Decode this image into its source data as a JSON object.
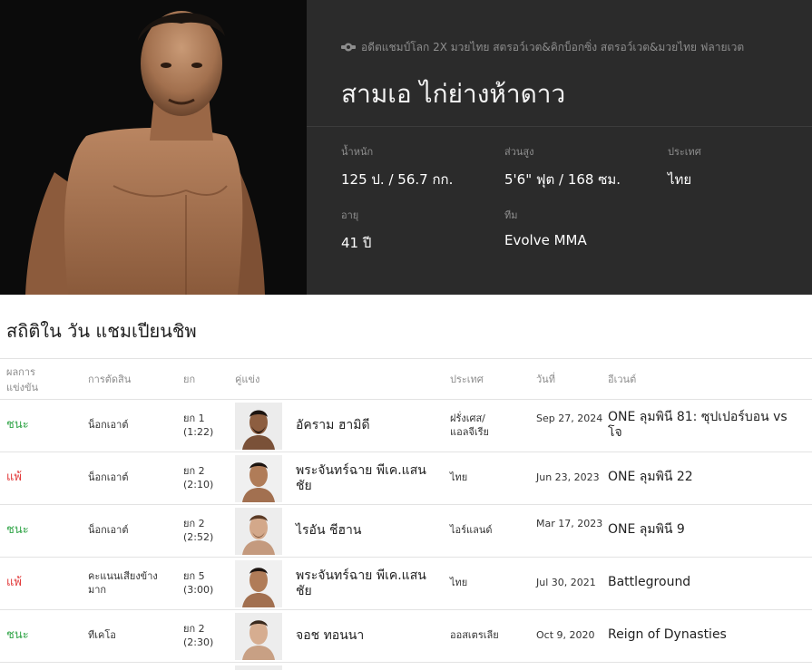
{
  "hero": {
    "subtitle": "อดีตแชมป์โลก 2X มวยไทย สตรอว์เวต&คิกบ็อกซิ่ง สตรอว์เวต&มวยไทย ฟลายเวต",
    "name": "สามเอ ไก่ย่างห้าดาว",
    "stats": {
      "weight": {
        "label": "น้ำหนัก",
        "value": "125 ป. / 56.7 กก."
      },
      "height": {
        "label": "ส่วนสูง",
        "value": "5'6\" ฟุต / 168 ซม."
      },
      "country": {
        "label": "ประเทศ",
        "value": "ไทย"
      },
      "age": {
        "label": "อายุ",
        "value": "41 ปี"
      },
      "team": {
        "label": "ทีม",
        "value": "Evolve MMA"
      }
    },
    "icon": "belt-icon"
  },
  "stats_section": {
    "title": "สถิติใน วัน แชมเปียนชิพ",
    "headers": {
      "result_line1": "ผลการ",
      "result_line2": "แข่งขัน",
      "method": "การตัดสิน",
      "round": "ยก",
      "opponent": "คู่แข่ง",
      "country": "ประเทศ",
      "date": "วันที่",
      "event": "อีเวนต์"
    },
    "rows": [
      {
        "result": "ชนะ",
        "outcome": "win",
        "method": "น็อกเอาต์",
        "round1": "ยก 1",
        "round2": "(1:22)",
        "opponent": "อัคราม ฮามิดี",
        "country": "ฝรั่งเศส/แอลจีเรีย",
        "date": "Sep 27, 2024",
        "event": "ONE ลุมพินี 81: ซุปเปอร์บอน vs โจ"
      },
      {
        "result": "แพ้",
        "outcome": "loss",
        "method": "น็อกเอาต์",
        "round1": "ยก 2",
        "round2": "(2:10)",
        "opponent": "พระจันทร์ฉาย พีเค.แสนชัย",
        "country": "ไทย",
        "date": "Jun 23, 2023",
        "event": "ONE ลุมพินี 22"
      },
      {
        "result": "ชนะ",
        "outcome": "win",
        "method": "น็อกเอาต์",
        "round1": "ยก 2",
        "round2": "(2:52)",
        "opponent": "ไรอัน ชีฮาน",
        "country": "ไอร์แลนด์",
        "date": "Mar 17, 2023",
        "event": "ONE ลุมพินี 9"
      },
      {
        "result": "แพ้",
        "outcome": "loss",
        "method": "คะแนนเสียงข้างมาก",
        "round1": "ยก 5",
        "round2": "(3:00)",
        "opponent": "พระจันทร์ฉาย พีเค.แสนชัย",
        "country": "ไทย",
        "date": "Jul 30, 2021",
        "event": "Battleground"
      },
      {
        "result": "ชนะ",
        "outcome": "win",
        "method": "ทีเคโอ",
        "round1": "ยก 2",
        "round2": "(2:30)",
        "opponent": "จอช ทอนนา",
        "country": "ออสเตรเลีย",
        "date": "Oct 9, 2020",
        "event": "Reign of Dynasties"
      }
    ]
  },
  "colors": {
    "win": "#35a64b",
    "loss": "#e23a3a",
    "hero_bg": "#2b2b2b"
  }
}
